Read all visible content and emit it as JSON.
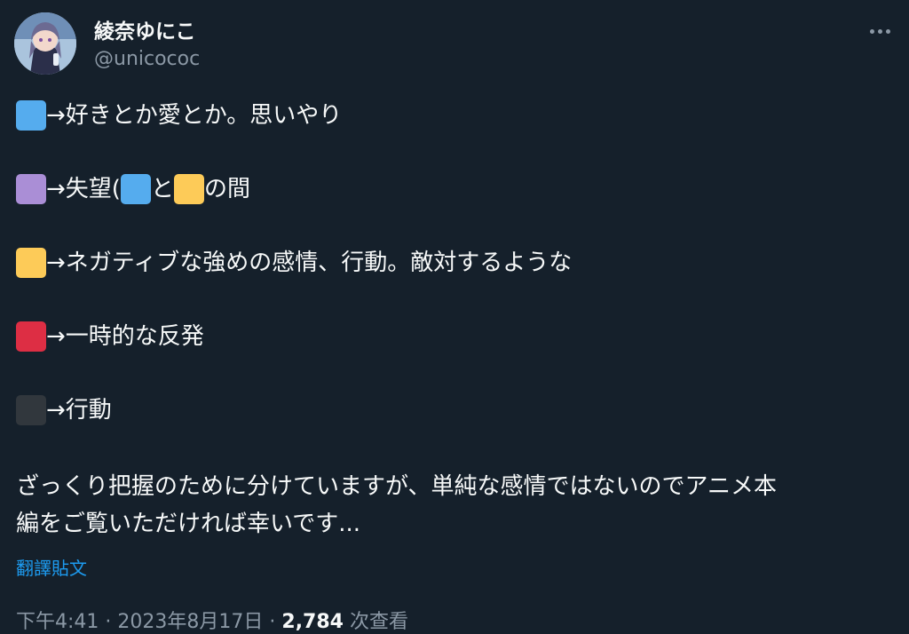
{
  "author": {
    "display_name": "綾奈ゆにこ",
    "handle": "@unicococ"
  },
  "lines": [
    {
      "emoji": "blue-square",
      "text": "→好きとか愛とか。思いやり"
    },
    {
      "emoji": "purple-square",
      "text_a": "→失望(",
      "inline_1": "blue-square",
      "text_b": "と",
      "inline_2": "yellow-square",
      "text_c": "の間"
    },
    {
      "emoji": "yellow-square",
      "text": "→ネガティブな強めの感情、行動。敵対するような"
    },
    {
      "emoji": "red-square",
      "text": "→一時的な反発"
    },
    {
      "emoji": "black-square",
      "text": "→行動"
    }
  ],
  "paragraph": {
    "line1": "ざっくり把握のために分けていますが、単純な感情ではないのでアニメ本",
    "line2": "編をご覧いただければ幸いです..."
  },
  "translate_label": "翻譯貼文",
  "meta": {
    "time": "下午4:41",
    "date": "2023年8月17日",
    "separator": "·",
    "views_count": "2,784",
    "views_label": "次查看"
  },
  "colors": {
    "background": "#15202b",
    "blue-square": "#55acee",
    "purple-square": "#aa8ed6",
    "yellow-square": "#fdcb58",
    "red-square": "#dd2e44",
    "black-square": "#31373d",
    "link": "#1d9bf0"
  }
}
